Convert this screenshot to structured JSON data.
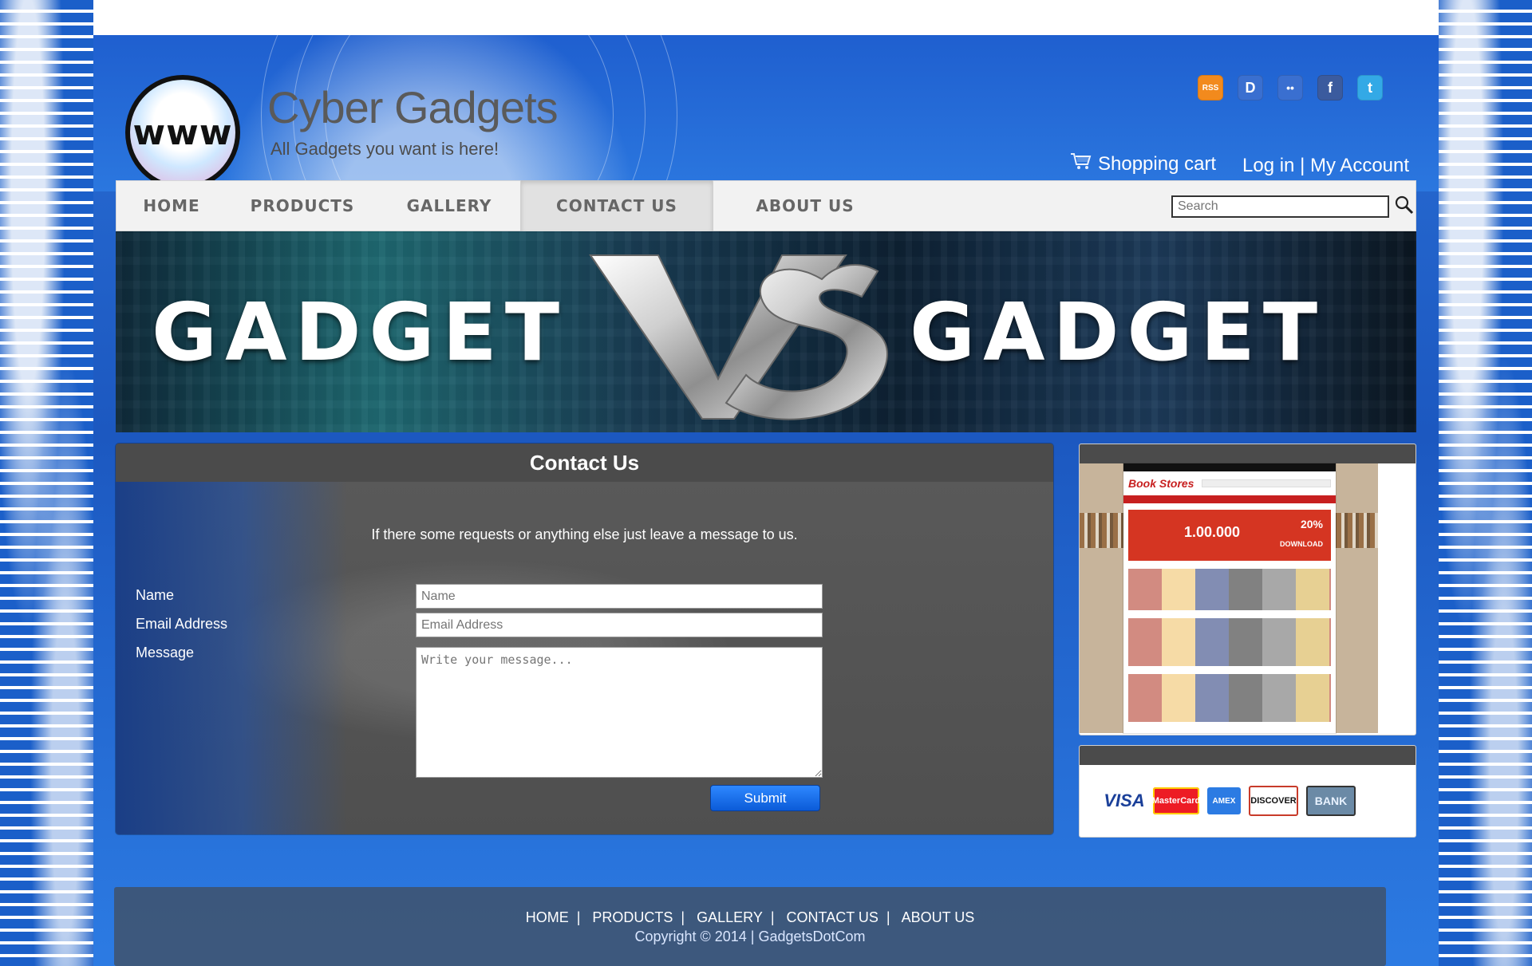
{
  "site": {
    "logo_text": "www",
    "title": "Cyber Gadgets",
    "tagline": "All Gadgets you want is here!"
  },
  "header": {
    "cart_label": "Shopping cart",
    "login_label": "Log in",
    "account_separator": "|",
    "account_label": "My Account"
  },
  "social": [
    {
      "name": "rss-icon",
      "glyph": "RSS"
    },
    {
      "name": "delicious-icon",
      "glyph": "D"
    },
    {
      "name": "flickr-icon",
      "glyph": "••"
    },
    {
      "name": "facebook-icon",
      "glyph": "f"
    },
    {
      "name": "twitter-icon",
      "glyph": "t"
    }
  ],
  "nav": {
    "items": [
      "HOME",
      "PRODUCTS",
      "GALLERY",
      "CONTACT US",
      "ABOUT US"
    ],
    "active": "CONTACT US",
    "search_placeholder": "Search"
  },
  "banner": {
    "left_word": "GADGET",
    "vs": "VS",
    "right_word": "GADGET"
  },
  "contact": {
    "title": "Contact Us",
    "intro": "If there some requests or anything else just leave a message to us.",
    "labels": {
      "name": "Name",
      "email": "Email Address",
      "message": "Message"
    },
    "placeholders": {
      "name": "Name",
      "email": "Email Address",
      "message": "Write your message..."
    },
    "submit_label": "Submit"
  },
  "sidebar": {
    "thumbnail_brand": "Book Stores",
    "thumbnail_promo": "1.00.000",
    "thumbnail_discount": "20%",
    "thumbnail_download": "DOWNLOAD"
  },
  "payments": [
    "VISA",
    "MasterCard",
    "AMEX",
    "DISCOVER",
    "BANK"
  ],
  "footer": {
    "links": [
      "HOME",
      "PRODUCTS",
      "GALLERY",
      "CONTACT US",
      "ABOUT US"
    ],
    "separator": "|",
    "copyright": "Copyright © 2014 | GadgetsDotCom"
  }
}
